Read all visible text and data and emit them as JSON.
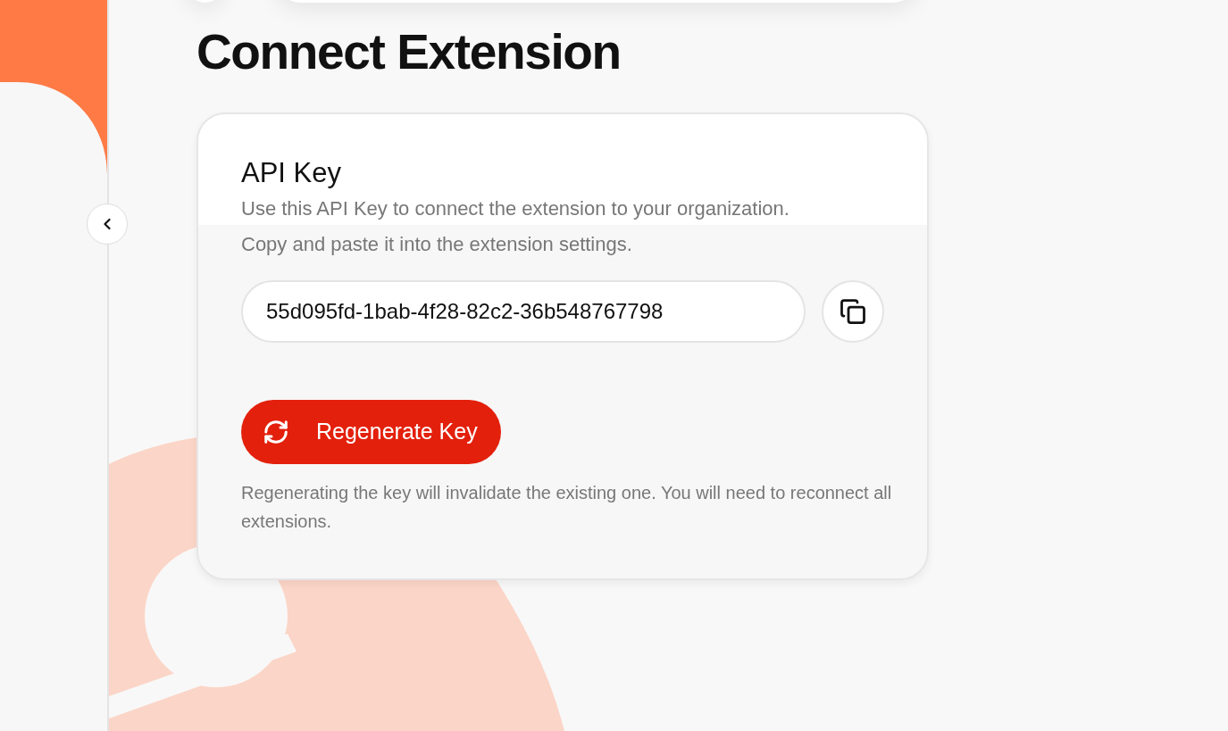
{
  "page": {
    "title": "Connect Extension"
  },
  "api_key_card": {
    "title": "API Key",
    "description": "Use this API Key to connect the extension to your organization. Copy and paste it into the extension settings.",
    "key_field": {
      "value": "55d095fd-1bab-4f28-82c2-36b548767798"
    },
    "regenerate_button": {
      "label": "Regenerate Key"
    },
    "note": "Regenerating the key will invalidate the existing one. You will need to reconnect all extensions."
  }
}
